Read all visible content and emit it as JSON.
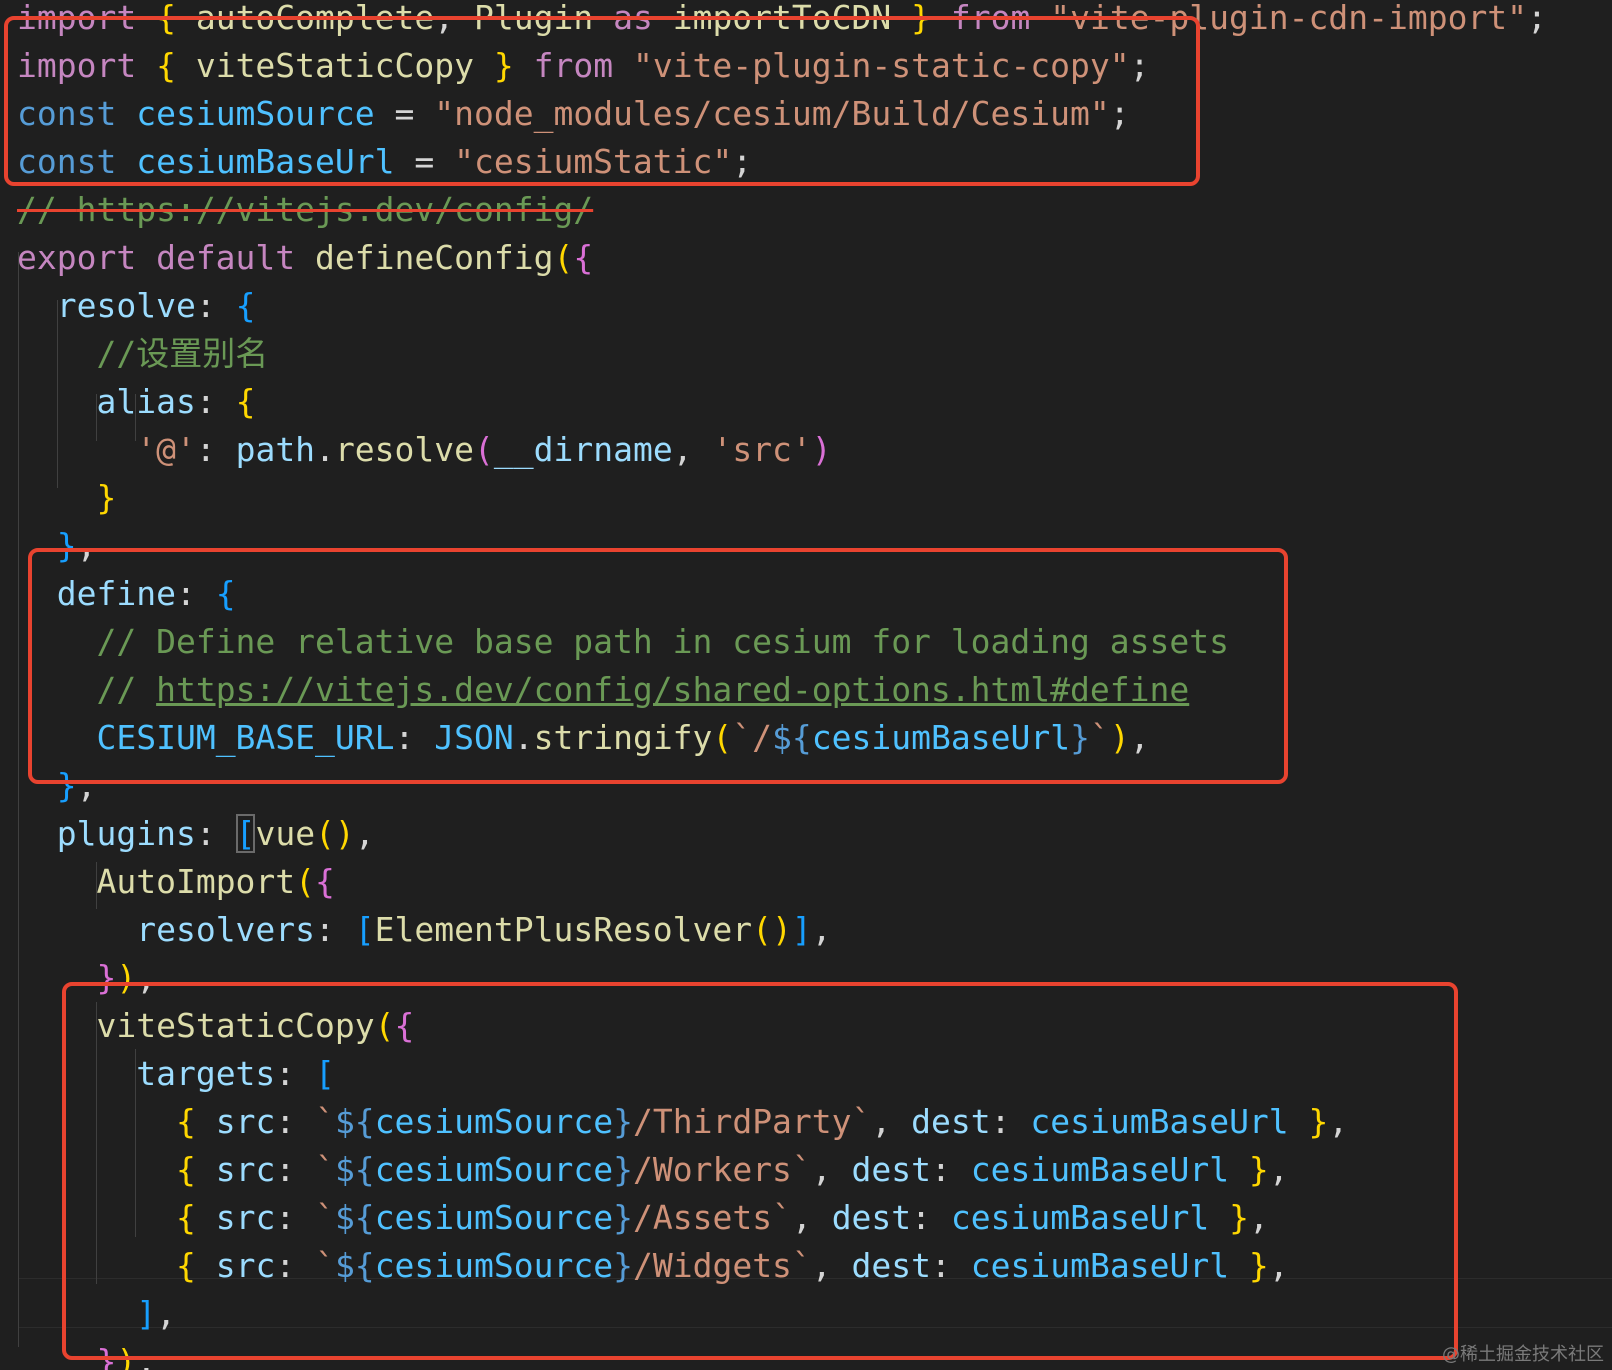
{
  "colors": {
    "background": "#1f1f1f",
    "highlight_box": "#e8432f",
    "keyword": "#c586c0",
    "keyword_blue": "#569cd6",
    "function": "#dcdcaa",
    "variable": "#9cdcfe",
    "constant": "#4fc1ff",
    "string": "#ce9178",
    "comment": "#6a9955"
  },
  "watermark": "@稀土掘金技术社区",
  "lines": [
    [
      [
        "kw",
        "import "
      ],
      [
        "b1",
        "{ "
      ],
      [
        "fn",
        "autoComplete"
      ],
      [
        "pun",
        ", "
      ],
      [
        "fn",
        "Plugin"
      ],
      [
        "kw",
        " as "
      ],
      [
        "fn",
        "importToCDN"
      ],
      [
        "b1",
        " }"
      ],
      [
        "kw",
        " from "
      ],
      [
        "str",
        "\"vite-plugin-cdn-import\""
      ],
      [
        "pun",
        ";"
      ]
    ],
    [
      [
        "kw",
        "import "
      ],
      [
        "b1",
        "{ "
      ],
      [
        "fn",
        "viteStaticCopy"
      ],
      [
        "b1",
        " }"
      ],
      [
        "kw",
        " from "
      ],
      [
        "str",
        "\"vite-plugin-static-copy\""
      ],
      [
        "pun",
        ";"
      ]
    ],
    [
      [
        "kwb",
        "const "
      ],
      [
        "cst",
        "cesiumSource"
      ],
      [
        "pun",
        " = "
      ],
      [
        "str",
        "\"node_modules/cesium/Build/Cesium\""
      ],
      [
        "pun",
        ";"
      ]
    ],
    [
      [
        "kwb",
        "const "
      ],
      [
        "cst",
        "cesiumBaseUrl"
      ],
      [
        "pun",
        " = "
      ],
      [
        "str",
        "\"cesiumStatic\""
      ],
      [
        "pun",
        ";"
      ]
    ],
    [
      [
        "cmt",
        "// "
      ],
      [
        "link",
        "https://vitejs.dev/config/"
      ]
    ],
    [
      [
        "kw",
        "export "
      ],
      [
        "kw",
        "default "
      ],
      [
        "fn",
        "defineConfig"
      ],
      [
        "b1",
        "("
      ],
      [
        "b2",
        "{"
      ]
    ],
    [
      [
        "pun",
        "  "
      ],
      [
        "var",
        "resolve"
      ],
      [
        "pun",
        ": "
      ],
      [
        "b3",
        "{"
      ]
    ],
    [
      [
        "pun",
        "    "
      ],
      [
        "cmt",
        "//设置别名"
      ]
    ],
    [
      [
        "pun",
        "    "
      ],
      [
        "var",
        "alias"
      ],
      [
        "pun",
        ": "
      ],
      [
        "b1",
        "{"
      ]
    ],
    [
      [
        "pun",
        "      "
      ],
      [
        "str",
        "'@'"
      ],
      [
        "pun",
        ": "
      ],
      [
        "var",
        "path"
      ],
      [
        "pun",
        "."
      ],
      [
        "fn",
        "resolve"
      ],
      [
        "b2",
        "("
      ],
      [
        "var",
        "__dirname"
      ],
      [
        "pun",
        ", "
      ],
      [
        "str",
        "'src'"
      ],
      [
        "b2",
        ")"
      ]
    ],
    [
      [
        "pun",
        "    "
      ],
      [
        "b1",
        "}"
      ]
    ],
    [
      [
        "pun",
        "  "
      ],
      [
        "b3",
        "}"
      ],
      [
        "pun",
        ","
      ]
    ],
    [
      [
        "pun",
        "  "
      ],
      [
        "var",
        "define"
      ],
      [
        "pun",
        ": "
      ],
      [
        "b3",
        "{"
      ]
    ],
    [
      [
        "pun",
        "    "
      ],
      [
        "cmt",
        "// Define relative base path in cesium for loading assets"
      ]
    ],
    [
      [
        "pun",
        "    "
      ],
      [
        "cmt",
        "// "
      ],
      [
        "link",
        "https://vitejs.dev/config/shared-options.html#define"
      ]
    ],
    [
      [
        "pun",
        "    "
      ],
      [
        "cst",
        "CESIUM_BASE_URL"
      ],
      [
        "pun",
        ": "
      ],
      [
        "cst",
        "JSON"
      ],
      [
        "pun",
        "."
      ],
      [
        "fn",
        "stringify"
      ],
      [
        "b1",
        "("
      ],
      [
        "str",
        "`/"
      ],
      [
        "kwb",
        "${"
      ],
      [
        "cst",
        "cesiumBaseUrl"
      ],
      [
        "kwb",
        "}"
      ],
      [
        "str",
        "`"
      ],
      [
        "b1",
        ")"
      ],
      [
        "pun",
        ","
      ]
    ],
    [
      [
        "pun",
        "  "
      ],
      [
        "b3",
        "}"
      ],
      [
        "pun",
        ","
      ]
    ],
    [
      [
        "pun",
        "  "
      ],
      [
        "var",
        "plugins"
      ],
      [
        "pun",
        ": "
      ],
      [
        "b3",
        "["
      ],
      [
        "fn",
        "vue"
      ],
      [
        "b1",
        "()"
      ],
      [
        "pun",
        ","
      ]
    ],
    [
      [
        "pun",
        "    "
      ],
      [
        "fn",
        "AutoImport"
      ],
      [
        "b1",
        "("
      ],
      [
        "b2",
        "{"
      ]
    ],
    [
      [
        "pun",
        "      "
      ],
      [
        "var",
        "resolvers"
      ],
      [
        "pun",
        ": "
      ],
      [
        "b3",
        "["
      ],
      [
        "fn",
        "ElementPlusResolver"
      ],
      [
        "b1",
        "()"
      ],
      [
        "b3",
        "]"
      ],
      [
        "pun",
        ","
      ]
    ],
    [
      [
        "pun",
        "    "
      ],
      [
        "b2",
        "}"
      ],
      [
        "b1",
        ")"
      ],
      [
        "pun",
        ","
      ]
    ],
    [
      [
        "pun",
        "    "
      ],
      [
        "fn",
        "viteStaticCopy"
      ],
      [
        "b1",
        "("
      ],
      [
        "b2",
        "{"
      ]
    ],
    [
      [
        "pun",
        "      "
      ],
      [
        "var",
        "targets"
      ],
      [
        "pun",
        ": "
      ],
      [
        "b3",
        "["
      ]
    ],
    [
      [
        "pun",
        "        "
      ],
      [
        "b1",
        "{ "
      ],
      [
        "var",
        "src"
      ],
      [
        "pun",
        ": "
      ],
      [
        "str",
        "`"
      ],
      [
        "kwb",
        "${"
      ],
      [
        "cst",
        "cesiumSource"
      ],
      [
        "kwb",
        "}"
      ],
      [
        "str",
        "/ThirdParty`"
      ],
      [
        "pun",
        ", "
      ],
      [
        "var",
        "dest"
      ],
      [
        "pun",
        ": "
      ],
      [
        "cst",
        "cesiumBaseUrl"
      ],
      [
        "b1",
        " }"
      ],
      [
        "pun",
        ","
      ]
    ],
    [
      [
        "pun",
        "        "
      ],
      [
        "b1",
        "{ "
      ],
      [
        "var",
        "src"
      ],
      [
        "pun",
        ": "
      ],
      [
        "str",
        "`"
      ],
      [
        "kwb",
        "${"
      ],
      [
        "cst",
        "cesiumSource"
      ],
      [
        "kwb",
        "}"
      ],
      [
        "str",
        "/Workers`"
      ],
      [
        "pun",
        ", "
      ],
      [
        "var",
        "dest"
      ],
      [
        "pun",
        ": "
      ],
      [
        "cst",
        "cesiumBaseUrl"
      ],
      [
        "b1",
        " }"
      ],
      [
        "pun",
        ","
      ]
    ],
    [
      [
        "pun",
        "        "
      ],
      [
        "b1",
        "{ "
      ],
      [
        "var",
        "src"
      ],
      [
        "pun",
        ": "
      ],
      [
        "str",
        "`"
      ],
      [
        "kwb",
        "${"
      ],
      [
        "cst",
        "cesiumSource"
      ],
      [
        "kwb",
        "}"
      ],
      [
        "str",
        "/Assets`"
      ],
      [
        "pun",
        ", "
      ],
      [
        "var",
        "dest"
      ],
      [
        "pun",
        ": "
      ],
      [
        "cst",
        "cesiumBaseUrl"
      ],
      [
        "b1",
        " }"
      ],
      [
        "pun",
        ","
      ]
    ],
    [
      [
        "pun",
        "        "
      ],
      [
        "b1",
        "{ "
      ],
      [
        "var",
        "src"
      ],
      [
        "pun",
        ": "
      ],
      [
        "str",
        "`"
      ],
      [
        "kwb",
        "${"
      ],
      [
        "cst",
        "cesiumSource"
      ],
      [
        "kwb",
        "}"
      ],
      [
        "str",
        "/Widgets`"
      ],
      [
        "pun",
        ", "
      ],
      [
        "var",
        "dest"
      ],
      [
        "pun",
        ": "
      ],
      [
        "cst",
        "cesiumBaseUrl"
      ],
      [
        "b1",
        " }"
      ],
      [
        "pun",
        ","
      ]
    ],
    [
      [
        "pun",
        "      "
      ],
      [
        "b3",
        "]"
      ],
      [
        "pun",
        ","
      ]
    ],
    [
      [
        "pun",
        "    "
      ],
      [
        "b2",
        "}"
      ],
      [
        "b1",
        ")"
      ],
      [
        "pun",
        ","
      ]
    ]
  ]
}
